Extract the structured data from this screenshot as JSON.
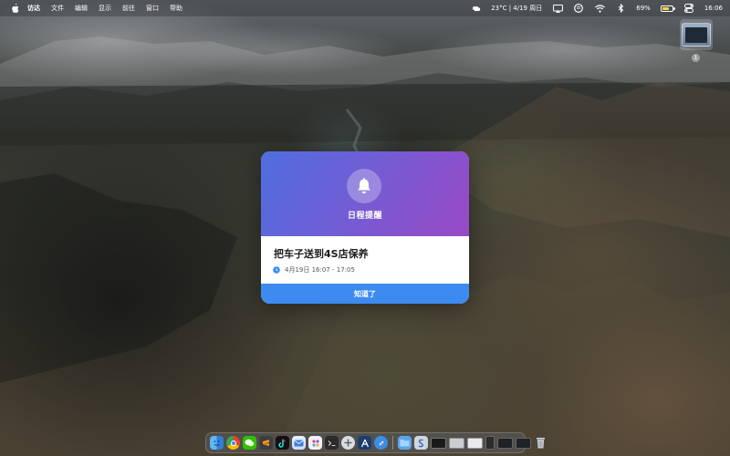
{
  "menubar": {
    "app_name": "访达",
    "menus": [
      "文件",
      "编辑",
      "显示",
      "前往",
      "窗口",
      "帮助"
    ],
    "weather": "23°C | 4/19 周日",
    "battery_percent": "69%",
    "battery_level": 0.69,
    "time": "16:06",
    "icons": [
      "screen-mirror-icon",
      "music-icon",
      "wifi-icon",
      "bluetooth-icon",
      "battery-icon",
      "control-center-icon"
    ]
  },
  "desktop": {
    "badge": "1"
  },
  "reminder": {
    "header_title": "日程提醒",
    "event_title": "把车子送到4S店保养",
    "event_time": "4月19日 16:07 - 17:05",
    "ack_button": "知道了",
    "colors": {
      "gradient_start": "#4f6ee0",
      "gradient_end": "#9a49c6",
      "button": "#3d8bf0"
    }
  },
  "dock": {
    "apps": [
      "finder-icon",
      "chrome-icon",
      "wechat-icon",
      "sublime-icon",
      "tiktok-icon",
      "mail-icon",
      "dots-app-icon",
      "terminal-icon",
      "launchpad-icon",
      "xcode-icon",
      "safari-icon"
    ],
    "others": [
      "files-folder-icon",
      "scripts-icon",
      "window-thumbnail-icon",
      "trash-icon"
    ]
  }
}
